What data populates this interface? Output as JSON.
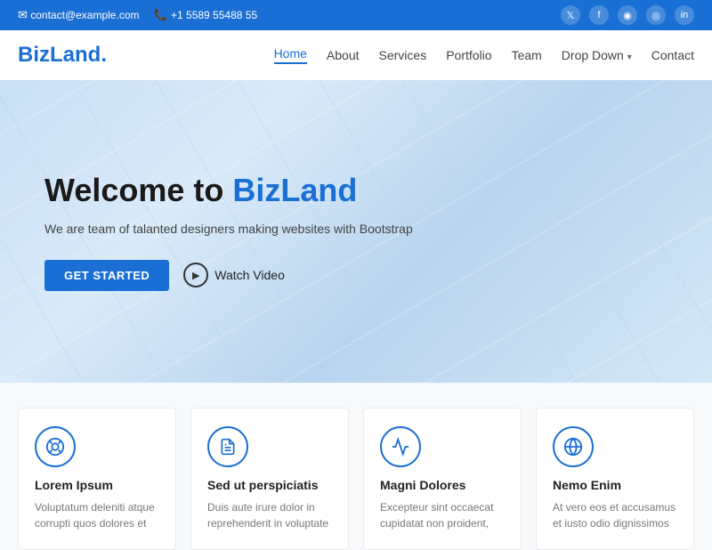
{
  "topbar": {
    "email": "contact@example.com",
    "phone": "+1 5589 55488 55",
    "email_icon": "✉",
    "phone_icon": "📞",
    "socials": [
      "𝕏",
      "f",
      "in",
      "◉",
      "in"
    ]
  },
  "header": {
    "logo_text": "BizLand",
    "logo_dot": ".",
    "nav": [
      {
        "label": "Home",
        "active": true
      },
      {
        "label": "About",
        "active": false
      },
      {
        "label": "Services",
        "active": false
      },
      {
        "label": "Portfolio",
        "active": false
      },
      {
        "label": "Team",
        "active": false
      },
      {
        "label": "Drop Down",
        "active": false,
        "dropdown": true
      },
      {
        "label": "Contact",
        "active": false
      }
    ]
  },
  "hero": {
    "title_plain": "Welcome to ",
    "title_highlight": "BizLand",
    "subtitle": "We are team of talanted designers making websites with Bootstrap",
    "cta_label": "GET STARTED",
    "watch_label": "Watch Video"
  },
  "cards": [
    {
      "icon": "⊕",
      "title": "Lorem Ipsum",
      "text": "Voluptatum deleniti atque corrupti quos dolores et"
    },
    {
      "icon": "📄",
      "title": "Sed ut perspiciatis",
      "text": "Duis aute irure dolor in reprehenderit in voluptate"
    },
    {
      "icon": "📊",
      "title": "Magni Dolores",
      "text": "Excepteur sint occaecat cupidatat non proident,"
    },
    {
      "icon": "🌐",
      "title": "Nemo Enim",
      "text": "At vero eos et accusamus et iusto odio dignissimos"
    }
  ]
}
